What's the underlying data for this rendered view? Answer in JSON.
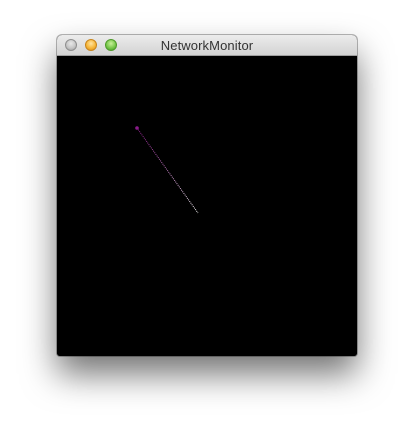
{
  "window": {
    "title": "NetworkMonitor"
  },
  "colors": {
    "background": "#000000",
    "trace_start": "#8a1b8a",
    "trace_end": "#ffffff"
  },
  "icons": {
    "close": "close-icon",
    "minimize": "minimize-icon",
    "zoom": "zoom-icon"
  }
}
